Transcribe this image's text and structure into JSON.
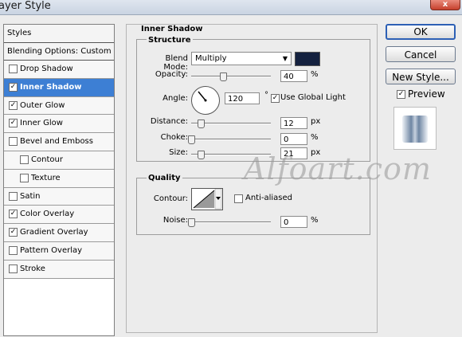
{
  "window": {
    "title": "ayer Style",
    "close_glyph": "x"
  },
  "styles_panel": {
    "header": "Styles",
    "blending_options": "Blending Options: Custom",
    "items": [
      {
        "label": "Drop Shadow",
        "checked": false,
        "selected": false,
        "indent": false
      },
      {
        "label": "Inner Shadow",
        "checked": true,
        "selected": true,
        "indent": false
      },
      {
        "label": "Outer Glow",
        "checked": true,
        "selected": false,
        "indent": false
      },
      {
        "label": "Inner Glow",
        "checked": true,
        "selected": false,
        "indent": false
      },
      {
        "label": "Bevel and Emboss",
        "checked": false,
        "selected": false,
        "indent": false
      },
      {
        "label": "Contour",
        "checked": false,
        "selected": false,
        "indent": true
      },
      {
        "label": "Texture",
        "checked": false,
        "selected": false,
        "indent": true
      },
      {
        "label": "Satin",
        "checked": false,
        "selected": false,
        "indent": false
      },
      {
        "label": "Color Overlay",
        "checked": true,
        "selected": false,
        "indent": false
      },
      {
        "label": "Gradient Overlay",
        "checked": true,
        "selected": false,
        "indent": false
      },
      {
        "label": "Pattern Overlay",
        "checked": false,
        "selected": false,
        "indent": false
      },
      {
        "label": "Stroke",
        "checked": false,
        "selected": false,
        "indent": false
      }
    ]
  },
  "inner_shadow": {
    "title": "Inner Shadow",
    "structure": {
      "title": "Structure",
      "blend_mode_label": "Blend Mode:",
      "blend_mode_value": "Multiply",
      "shadow_color": "#14213f",
      "opacity_label": "Opacity:",
      "opacity_value": "40",
      "opacity_fraction": 0.4,
      "opacity_unit": "%",
      "angle_label": "Angle:",
      "angle_value": "120",
      "angle_unit": "°",
      "use_global_light_label": "Use Global Light",
      "use_global_light": true,
      "distance_label": "Distance:",
      "distance_value": "12",
      "distance_fraction": 0.12,
      "distance_unit": "px",
      "choke_label": "Choke:",
      "choke_value": "0",
      "choke_fraction": 0.0,
      "choke_unit": "%",
      "size_label": "Size:",
      "size_value": "21",
      "size_fraction": 0.12,
      "size_unit": "px"
    },
    "quality": {
      "title": "Quality",
      "contour_label": "Contour:",
      "anti_aliased_label": "Anti-aliased",
      "anti_aliased": false,
      "noise_label": "Noise:",
      "noise_value": "0",
      "noise_fraction": 0.0,
      "noise_unit": "%"
    }
  },
  "buttons": {
    "ok": "OK",
    "cancel": "Cancel",
    "new_style": "New Style...",
    "preview_label": "Preview",
    "preview_checked": true
  },
  "watermark": "Alfoart.com"
}
